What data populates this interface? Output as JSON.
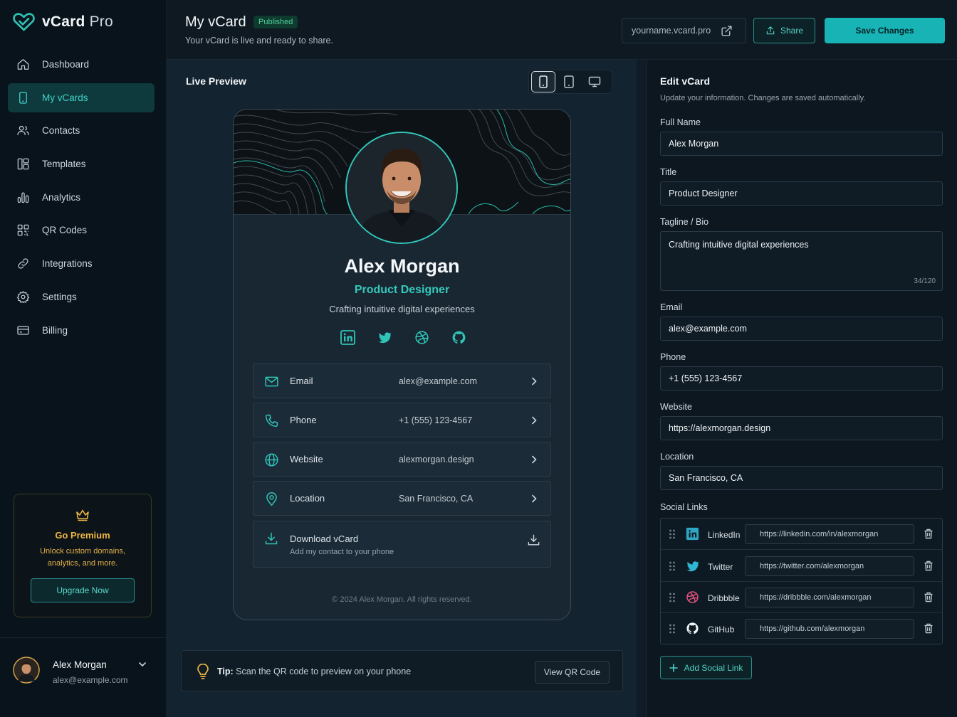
{
  "app": {
    "name_bold": "vCard",
    "name_light": "Pro"
  },
  "colors": {
    "accent": "#18b3b4",
    "teal_text": "#34c9bb",
    "premium": "#f0b63f",
    "published": "#4fd49a"
  },
  "sidebar": {
    "items": [
      {
        "label": "Dashboard",
        "icon": "home-icon"
      },
      {
        "label": "My vCards",
        "icon": "phone-card-icon",
        "active": true
      },
      {
        "label": "Contacts",
        "icon": "users-icon"
      },
      {
        "label": "Templates",
        "icon": "templates-icon"
      },
      {
        "label": "Analytics",
        "icon": "bar-chart-icon"
      },
      {
        "label": "QR Codes",
        "icon": "qr-code-icon"
      },
      {
        "label": "Integrations",
        "icon": "link-icon"
      },
      {
        "label": "Settings",
        "icon": "gear-icon"
      },
      {
        "label": "Billing",
        "icon": "credit-card-icon"
      }
    ],
    "premium": {
      "title": "Go Premium",
      "description": "Unlock custom domains, analytics, and more.",
      "button": "Upgrade Now"
    },
    "user": {
      "name": "Alex Morgan",
      "email": "alex@example.com"
    }
  },
  "header": {
    "title": "My vCard",
    "badge": "Published",
    "subtitle": "Your vCard is live and ready to share.",
    "url": "yourname.vcard.pro",
    "share": "Share",
    "save": "Save Changes"
  },
  "preview": {
    "label": "Live Preview",
    "card": {
      "name": "Alex Morgan",
      "title": "Product Designer",
      "tagline": "Crafting intuitive digital experiences",
      "socials": [
        "linkedin-icon",
        "twitter-icon",
        "dribbble-icon",
        "github-icon"
      ],
      "rows": [
        {
          "label": "Email",
          "value": "alex@example.com",
          "icon": "mail-icon"
        },
        {
          "label": "Phone",
          "value": "+1 (555) 123-4567",
          "icon": "phone-icon"
        },
        {
          "label": "Website",
          "value": "alexmorgan.design",
          "icon": "globe-icon"
        },
        {
          "label": "Location",
          "value": "San Francisco, CA",
          "icon": "map-pin-icon"
        }
      ],
      "download": {
        "label": "Download vCard",
        "sub": "Add my contact to your phone"
      },
      "copyright": "© 2024 Alex Morgan. All rights reserved."
    },
    "tip": {
      "bold": "Tip:",
      "text": "Scan the QR code to preview on your phone",
      "button": "View QR Code"
    }
  },
  "edit": {
    "title": "Edit vCard",
    "subtitle": "Update your information. Changes are saved automatically.",
    "fields": {
      "full_name": {
        "label": "Full Name",
        "value": "Alex Morgan"
      },
      "title": {
        "label": "Title",
        "value": "Product Designer"
      },
      "bio": {
        "label": "Tagline / Bio",
        "value": "Crafting intuitive digital experiences",
        "count": "34/120"
      },
      "email": {
        "label": "Email",
        "value": "alex@example.com"
      },
      "phone": {
        "label": "Phone",
        "value": "+1 (555) 123-4567"
      },
      "website": {
        "label": "Website",
        "value": "https://alexmorgan.design"
      },
      "location": {
        "label": "Location",
        "value": "San Francisco, CA"
      }
    },
    "social_label": "Social Links",
    "social_links": [
      {
        "name": "LinkedIn",
        "url": "https://linkedin.com/in/alexmorgan",
        "icon": "linkedin-icon"
      },
      {
        "name": "Twitter",
        "url": "https://twitter.com/alexmorgan",
        "icon": "twitter-icon"
      },
      {
        "name": "Dribbble",
        "url": "https://dribbble.com/alexmorgan",
        "icon": "dribbble-icon"
      },
      {
        "name": "GitHub",
        "url": "https://github.com/alexmorgan",
        "icon": "github-icon"
      }
    ],
    "add_social": "Add Social Link"
  }
}
